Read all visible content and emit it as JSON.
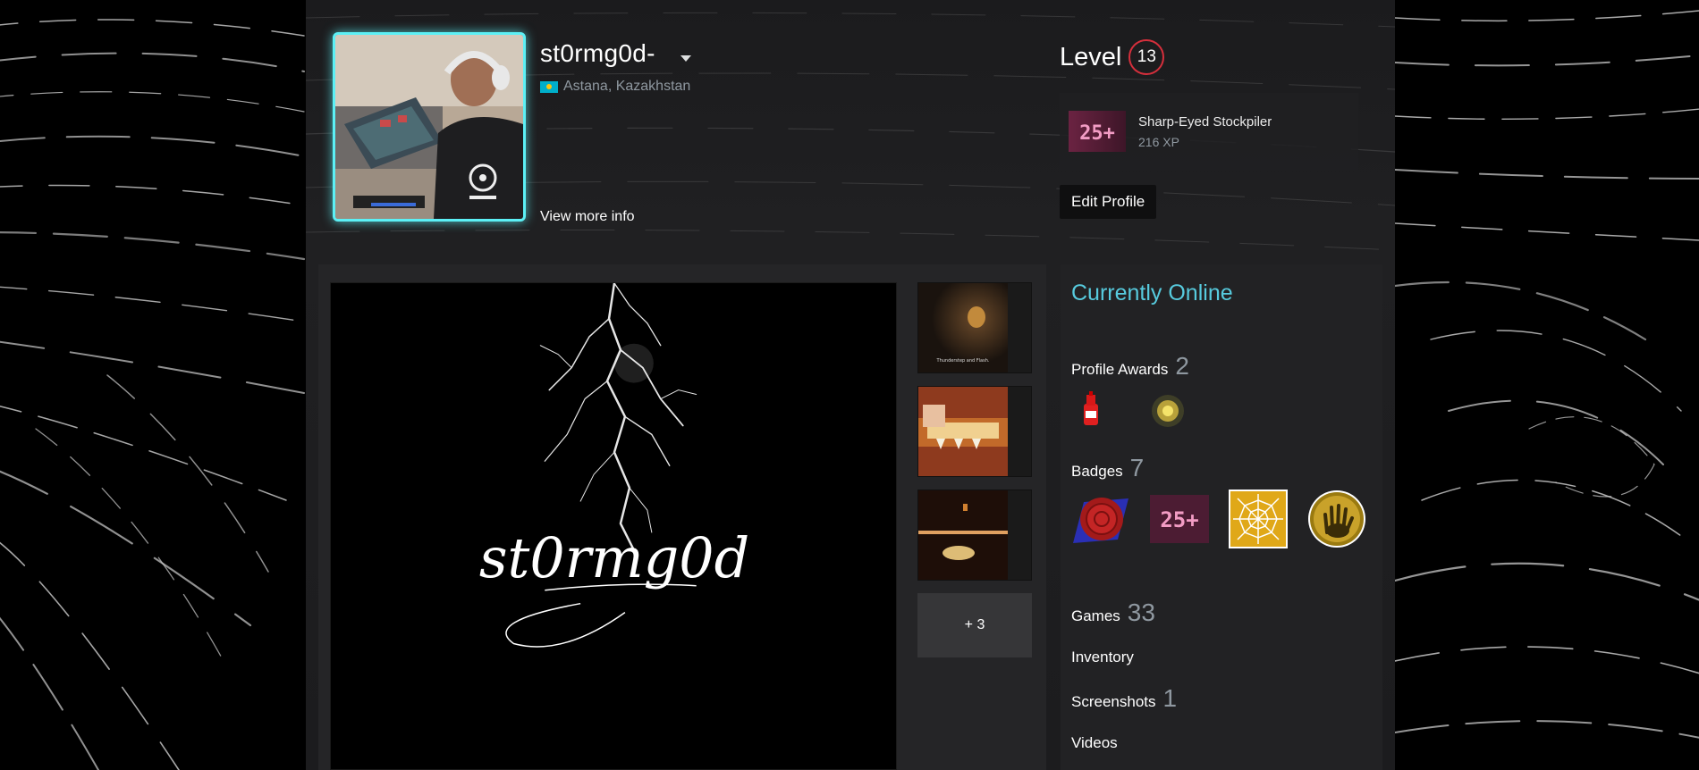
{
  "profile": {
    "persona_name": "st0rmg0d-",
    "location": "Astana, Kazakhstan",
    "view_more_label": "View more info",
    "avatar_icon": "avatar",
    "flag_icon": "kazakhstan-flag-icon"
  },
  "level": {
    "label": "Level",
    "value": "13"
  },
  "favorite_badge": {
    "icon_text": "25+",
    "name": "Sharp-Eyed Stockpiler",
    "xp": "216 XP"
  },
  "edit_profile_label": "Edit Profile",
  "showcase": {
    "signature_text": "st0rmg0d",
    "more_label": "+ 3",
    "thumbnail_caption": "Thunderstep and Flash."
  },
  "sidebar": {
    "online_status": "Currently Online",
    "profile_awards": {
      "label": "Profile Awards",
      "count": "2"
    },
    "badges": {
      "label": "Badges",
      "count": "7",
      "badge_25_text": "25+"
    },
    "games": {
      "label": "Games",
      "count": "33"
    },
    "inventory": {
      "label": "Inventory"
    },
    "screenshots": {
      "label": "Screenshots",
      "count": "1"
    },
    "videos": {
      "label": "Videos"
    }
  },
  "colors": {
    "avatar_frame": "#5cf0f5",
    "level_ring": "#d62f3c",
    "online": "#57cbde"
  }
}
